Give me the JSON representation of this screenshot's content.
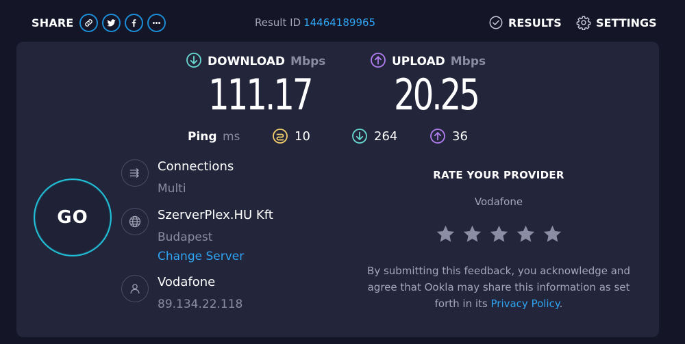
{
  "header": {
    "share_label": "SHARE",
    "share_buttons": [
      "link-icon",
      "twitter-icon",
      "facebook-icon",
      "more-icon"
    ],
    "result_id_label": "Result ID",
    "result_id_value": "14464189965",
    "results_label": "RESULTS",
    "settings_label": "SETTINGS"
  },
  "download": {
    "title": "DOWNLOAD",
    "unit": "Mbps",
    "value": "111.17",
    "color": "#67d9d0"
  },
  "upload": {
    "title": "UPLOAD",
    "unit": "Mbps",
    "value": "20.25",
    "color": "#b17ef0"
  },
  "ping": {
    "label": "Ping",
    "unit": "ms",
    "idle": "10",
    "download": "264",
    "upload": "36",
    "idle_color": "#f2cf6b"
  },
  "go": {
    "label": "GO"
  },
  "connections": {
    "title": "Connections",
    "value": "Multi"
  },
  "server": {
    "name": "SzerverPlex.HU Kft",
    "location": "Budapest",
    "change_label": "Change Server"
  },
  "isp": {
    "name": "Vodafone",
    "ip": "89.134.22.118"
  },
  "rate": {
    "title": "RATE YOUR PROVIDER",
    "provider": "Vodafone",
    "stars_total": 5,
    "note_before": "By submitting this feedback, you acknowledge and agree that Ookla may share this information as set forth in its",
    "note_link": "Privacy Policy",
    "note_after": "."
  },
  "colors": {
    "accent_blue": "#2fa4f2",
    "go_ring": "#21c2d9",
    "background": "#141526",
    "panel": "#23253b"
  }
}
